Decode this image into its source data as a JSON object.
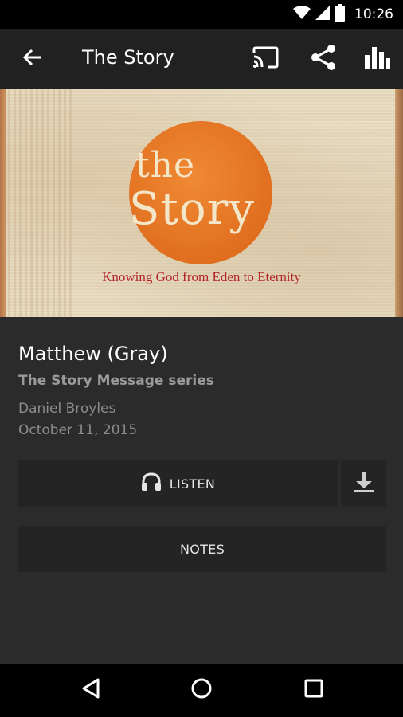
{
  "status_bar": {
    "time": "10:26",
    "icons": [
      "wifi-icon",
      "signal-icon",
      "battery-icon"
    ]
  },
  "app_bar": {
    "title": "The Story",
    "actions": [
      "cast-icon",
      "share-icon",
      "stats-icon"
    ]
  },
  "artwork": {
    "title_the": "the",
    "title_story": "Story",
    "tagline": "Knowing God from Eden to Eternity",
    "accent_color": "#e8762a",
    "tagline_color": "#b2262a"
  },
  "sermon": {
    "title": "Matthew (Gray)",
    "series": "The Story Message series",
    "speaker": "Daniel Broyles",
    "date": "October 11, 2015"
  },
  "buttons": {
    "listen_label": "LISTEN",
    "notes_label": "NOTES"
  },
  "nav_bar": {
    "items": [
      "back-triangle-icon",
      "home-circle-icon",
      "recents-square-icon"
    ]
  }
}
